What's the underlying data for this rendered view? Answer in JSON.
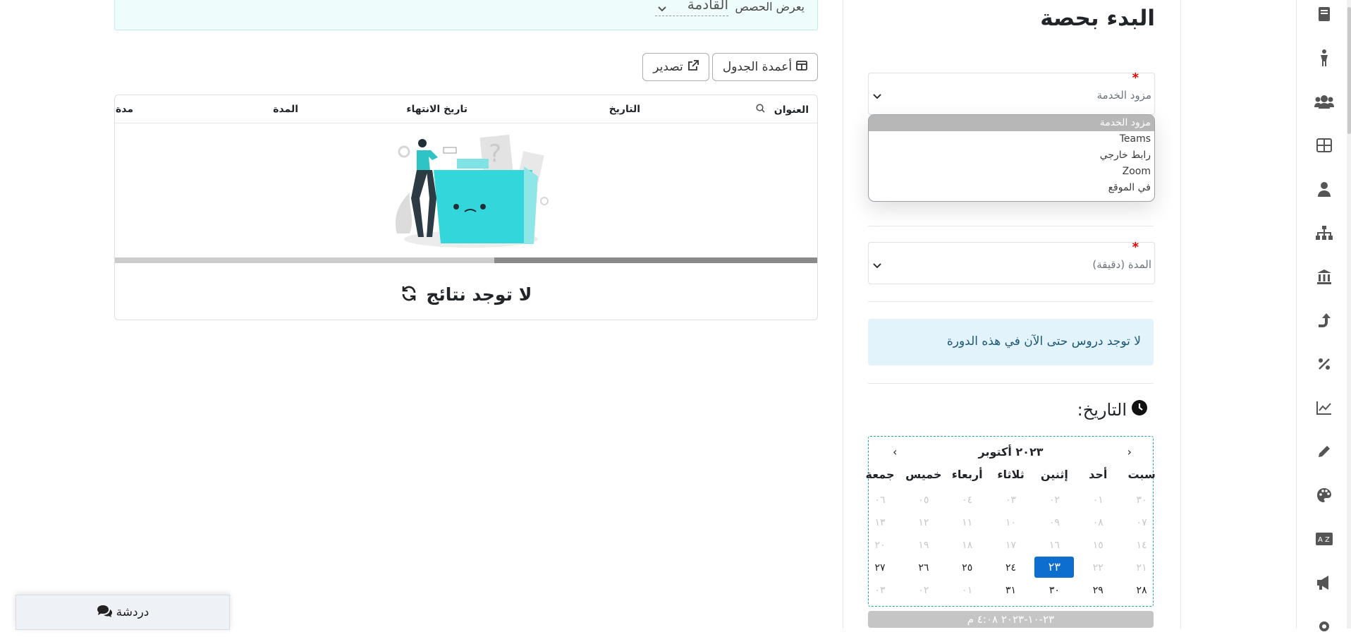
{
  "filter": {
    "label": "يعرض الحصص",
    "selected": "القادمة"
  },
  "toolbar": {
    "columns_label": "أعمدة الجدول",
    "export_label": "تصدير"
  },
  "table": {
    "columns": [
      "العنوان",
      "التاريخ",
      "تاريخ الانتهاء",
      "المدة",
      "مدة"
    ],
    "empty_message": "لا توجد نتائج"
  },
  "chat": {
    "label": "دردشة"
  },
  "form": {
    "title": "البدء بحصة",
    "provider_placeholder": "مزود الخدمة",
    "provider_options": [
      "مزود الخدمة",
      "Teams",
      "رابط خارجي",
      "Zoom",
      "في الموقع"
    ],
    "duration_placeholder": "المدة (دقيقة)",
    "no_lessons_message": "لا توجد دروس حتى الآن في هذه الدورة",
    "date_label": "التاريخ:",
    "datetime_value": "٢٣-١٠-٢٠٢٣ ٤:٠٨ م"
  },
  "calendar": {
    "month_label": "٢٠٢٣ أكتوبر",
    "prev": "‹",
    "next": "›",
    "weekdays": [
      "سبت",
      "أحد",
      "إثنين",
      "ثلاثاء",
      "أربعاء",
      "خميس",
      "جمعة"
    ],
    "selected_day": "٢٣",
    "weeks": [
      [
        "٣٠",
        "٠١",
        "٠٢",
        "٠٣",
        "٠٤",
        "٠٥",
        "٠٦"
      ],
      [
        "٠٧",
        "٠٨",
        "٠٩",
        "١٠",
        "١١",
        "١٢",
        "١٣"
      ],
      [
        "١٤",
        "١٥",
        "١٦",
        "١٧",
        "١٨",
        "١٩",
        "٢٠"
      ],
      [
        "٢١",
        "٢٢",
        "٢٣",
        "٢٤",
        "٢٥",
        "٢٦",
        "٢٧"
      ],
      [
        "٢٨",
        "٢٩",
        "٣٠",
        "٣١",
        "٠١",
        "٠٢",
        "٠٣"
      ]
    ],
    "muted_days_count_by_week": [
      7,
      7,
      7,
      2,
      0
    ]
  },
  "sidebar_icons": [
    "book-icon",
    "person-icon",
    "users-icon",
    "table-icon",
    "user-tie-icon",
    "sitemap-icon",
    "building-icon",
    "arrow-up-icon",
    "percent-icon",
    "line-chart-icon",
    "pencil-icon",
    "palette-icon",
    "language-icon",
    "megaphone-icon",
    "gear-icon"
  ],
  "colors": {
    "accent": "#0d6ecf",
    "required": "#e00000",
    "teal": "#2ec4c6"
  }
}
